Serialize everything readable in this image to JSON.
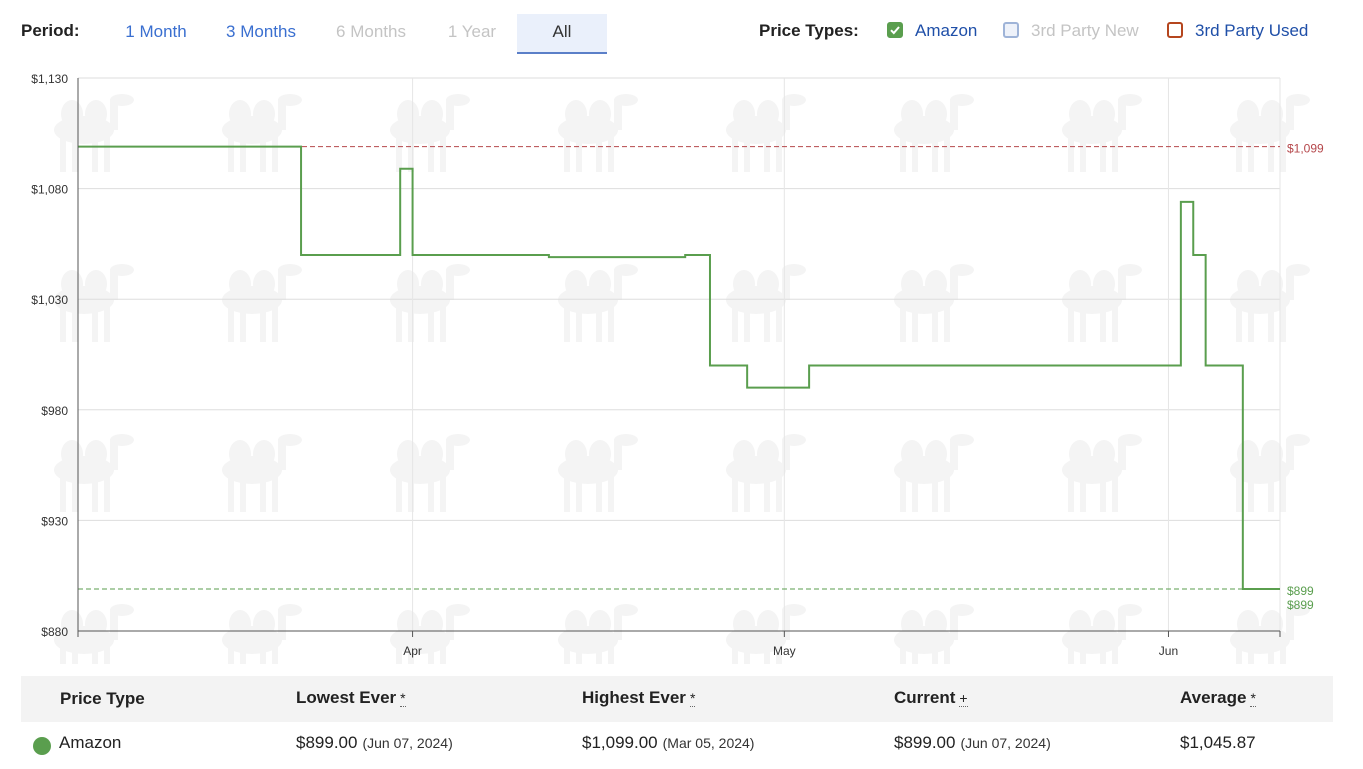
{
  "header": {
    "period_label": "Period:",
    "periods": [
      {
        "label": "1 Month",
        "state": "enabled"
      },
      {
        "label": "3 Months",
        "state": "enabled"
      },
      {
        "label": "6 Months",
        "state": "disabled"
      },
      {
        "label": "1 Year",
        "state": "disabled"
      },
      {
        "label": "All",
        "state": "active"
      }
    ],
    "price_types_label": "Price Types:",
    "price_types": [
      {
        "label": "Amazon",
        "checked": true,
        "color": "#5a9e4e",
        "text_color": "#1f4fa8"
      },
      {
        "label": "3rd Party New",
        "checked": false,
        "color": "#9fb4d8",
        "text_color": "#c4c4c4"
      },
      {
        "label": "3rd Party Used",
        "checked": false,
        "color": "#b5461e",
        "text_color": "#1f4fa8"
      }
    ]
  },
  "chart_data": {
    "type": "line",
    "step": true,
    "y_ticks": [
      "$1,130",
      "$1,080",
      "$1,030",
      "$980",
      "$930",
      "$880"
    ],
    "ylim": [
      880,
      1130
    ],
    "xlim": [
      "2024-03-05",
      "2024-06-10"
    ],
    "x_ticks": [
      {
        "date": "2024-04-01",
        "label": "Apr"
      },
      {
        "date": "2024-05-01",
        "label": "May"
      },
      {
        "date": "2024-06-01",
        "label": "Jun"
      }
    ],
    "grid": true,
    "series": [
      {
        "name": "Amazon",
        "color": "#5a9e4e",
        "points": [
          {
            "date": "2024-03-05",
            "value": 1099
          },
          {
            "date": "2024-03-23",
            "value": 1050
          },
          {
            "date": "2024-03-31",
            "value": 1089
          },
          {
            "date": "2024-04-01",
            "value": 1050
          },
          {
            "date": "2024-04-12",
            "value": 1049
          },
          {
            "date": "2024-04-23",
            "value": 1050
          },
          {
            "date": "2024-04-25",
            "value": 1000
          },
          {
            "date": "2024-04-28",
            "value": 990
          },
          {
            "date": "2024-05-03",
            "value": 1000
          },
          {
            "date": "2024-06-02",
            "value": 1074
          },
          {
            "date": "2024-06-03",
            "value": 1050
          },
          {
            "date": "2024-06-04",
            "value": 1000
          },
          {
            "date": "2024-06-07",
            "value": 899
          },
          {
            "date": "2024-06-10",
            "value": 899
          }
        ]
      }
    ],
    "reference_lines": [
      {
        "value": 1099,
        "label": "$1,099",
        "color": "#b5474b"
      },
      {
        "value": 899,
        "label": "$899",
        "color": "#5a9e4e"
      }
    ],
    "current_label": {
      "value": 899,
      "label": "$899",
      "color": "#5a9e4e"
    }
  },
  "table": {
    "headers": [
      "Price Type",
      "Lowest Ever",
      "Highest Ever",
      "Current",
      "Average"
    ],
    "header_marks": [
      "",
      "*",
      "*",
      "+",
      "*"
    ],
    "rows": [
      {
        "color": "#5a9e4e",
        "type": "Amazon",
        "lowest": "$899.00",
        "lowest_date": "(Jun 07, 2024)",
        "highest": "$1,099.00",
        "highest_date": "(Mar 05, 2024)",
        "current": "$899.00",
        "current_date": "(Jun 07, 2024)",
        "average": "$1,045.87"
      }
    ]
  }
}
